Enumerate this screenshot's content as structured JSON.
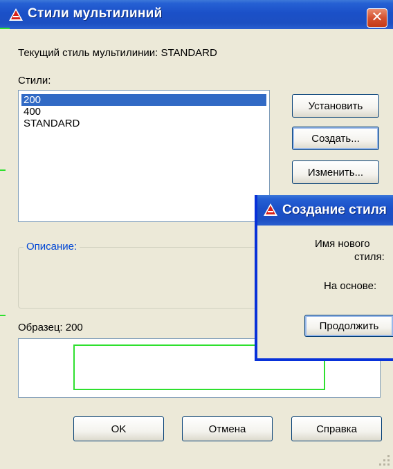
{
  "dialog": {
    "title": "Стили мультилиний",
    "current_style_label": "Текущий стиль мультилинии: STANDARD",
    "styles_label": "Стили:",
    "styles_list": [
      "200",
      "400",
      "STANDARD"
    ],
    "buttons": {
      "set": "Установить",
      "create": "Создать...",
      "modify": "Изменить..."
    },
    "description_label": "Описание:",
    "preview_label": "Образец: 200",
    "footer_buttons": {
      "ok": "OK",
      "cancel": "Отмена",
      "help": "Справка"
    },
    "close_symbol": "✕"
  },
  "new_style_dialog": {
    "title": "Создание стиля",
    "name_label_line1": "Имя нового",
    "name_label_line2": "стиля:",
    "based_on_label": "На основе:",
    "continue_button": "Продолжить"
  },
  "colors": {
    "titlebar": "#1c4fc2",
    "selection": "#316ac5",
    "accent_label": "#0046d5",
    "preview_line": "#2ee02e",
    "close_button": "#d55130"
  },
  "icons": [
    "app-icon",
    "close-icon",
    "resize-grip-icon"
  ]
}
